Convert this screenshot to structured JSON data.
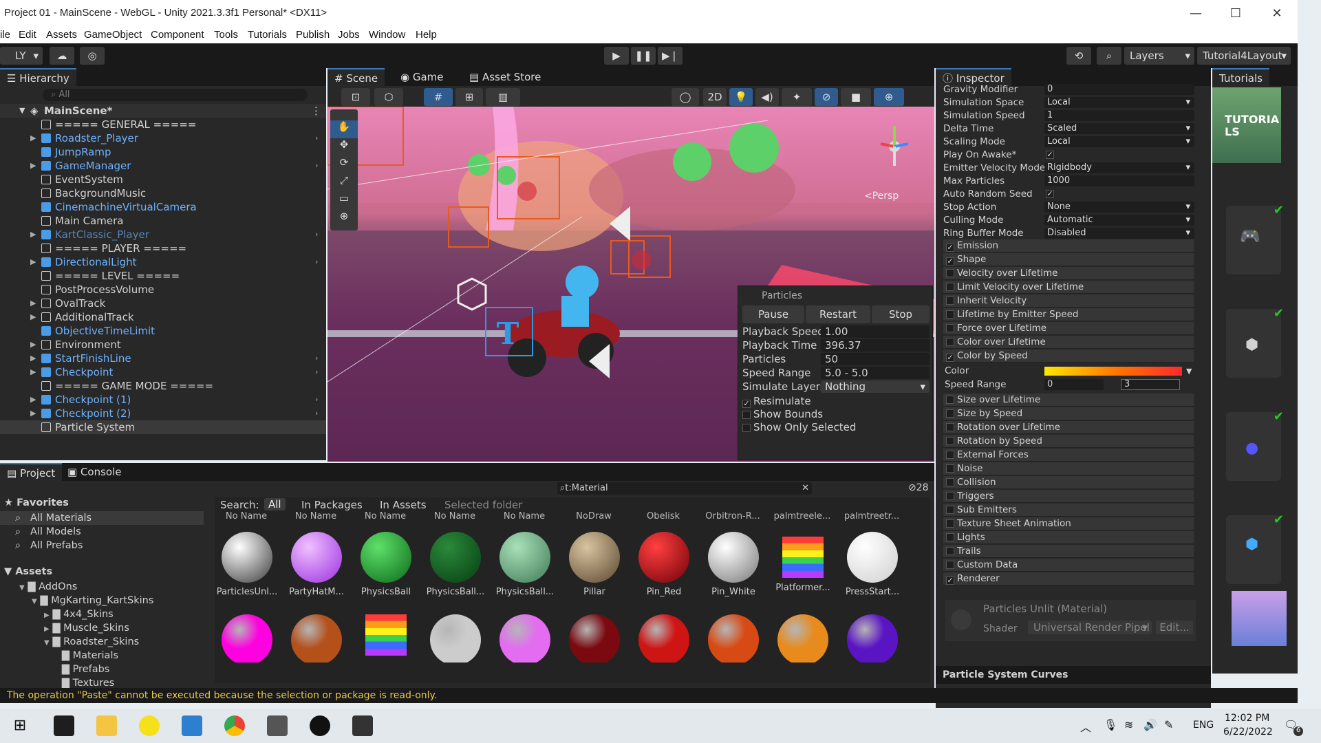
{
  "window": {
    "title": "Project 01 - MainScene - WebGL - Unity 2021.3.3f1 Personal* <DX11>"
  },
  "menu": [
    "ile",
    "Edit",
    "Assets",
    "GameObject",
    "Component",
    "Tools",
    "Tutorials",
    "Publish",
    "Jobs",
    "Window",
    "Help"
  ],
  "toolbar": {
    "account": "LY",
    "layers": "Layers",
    "layout": "Tutorial4Layout"
  },
  "hierarchy": {
    "tab": "Hierarchy",
    "search_placeholder": "All",
    "scene": "MainScene*",
    "items": [
      {
        "label": "===== GENERAL =====",
        "blue": false,
        "arrow": false
      },
      {
        "label": "Roadster_Player",
        "blue": true,
        "arrow": true
      },
      {
        "label": "JumpRamp",
        "blue": true,
        "arrow": false
      },
      {
        "label": "GameManager",
        "blue": true,
        "arrow": true
      },
      {
        "label": "EventSystem",
        "blue": false,
        "arrow": false
      },
      {
        "label": "BackgroundMusic",
        "blue": false,
        "arrow": false
      },
      {
        "label": "CinemachineVirtualCamera",
        "blue": true,
        "arrow": false
      },
      {
        "label": "Main Camera",
        "blue": false,
        "arrow": false
      },
      {
        "label": "KartClassic_Player",
        "blue": true,
        "arrow": true,
        "dim": true
      },
      {
        "label": "===== PLAYER =====",
        "blue": false,
        "arrow": false
      },
      {
        "label": "DirectionalLight",
        "blue": true,
        "arrow": true
      },
      {
        "label": "===== LEVEL =====",
        "blue": false,
        "arrow": false
      },
      {
        "label": "PostProcessVolume",
        "blue": false,
        "arrow": false
      },
      {
        "label": "OvalTrack",
        "blue": false,
        "arrow": true
      },
      {
        "label": "AdditionalTrack",
        "blue": false,
        "arrow": true
      },
      {
        "label": "ObjectiveTimeLimit",
        "blue": true,
        "arrow": false
      },
      {
        "label": "Environment",
        "blue": false,
        "arrow": true
      },
      {
        "label": "StartFinishLine",
        "blue": true,
        "arrow": true
      },
      {
        "label": "Checkpoint",
        "blue": true,
        "arrow": true
      },
      {
        "label": "===== GAME MODE =====",
        "blue": false,
        "arrow": false
      },
      {
        "label": "Checkpoint (1)",
        "blue": true,
        "arrow": true
      },
      {
        "label": "Checkpoint (2)",
        "blue": true,
        "arrow": true
      },
      {
        "label": "Particle System",
        "blue": false,
        "arrow": false
      }
    ]
  },
  "scene": {
    "tabs": [
      "Scene",
      "Game",
      "Asset Store"
    ],
    "persp": "<Persp",
    "btn2d": "2D"
  },
  "particles": {
    "title": "Particles",
    "pause": "Pause",
    "restart": "Restart",
    "stop": "Stop",
    "rows": [
      {
        "k": "Playback Speed",
        "v": "1.00"
      },
      {
        "k": "Playback Time",
        "v": "396.37"
      },
      {
        "k": "Particles",
        "v": "50"
      },
      {
        "k": "Speed Range",
        "v": "5.0 - 5.0"
      },
      {
        "k": "Simulate Layers",
        "v": "Nothing"
      }
    ],
    "checks": [
      {
        "k": "Resimulate",
        "on": true
      },
      {
        "k": "Show Bounds",
        "on": false
      },
      {
        "k": "Show Only Selected",
        "on": false
      }
    ]
  },
  "inspector": {
    "tab": "Inspector",
    "props": [
      {
        "k": "Gravity Modifier",
        "v": "0",
        "dd": false
      },
      {
        "k": "Simulation Space",
        "v": "Local",
        "dd": true
      },
      {
        "k": "Simulation Speed",
        "v": "1",
        "dd": false
      },
      {
        "k": "Delta Time",
        "v": "Scaled",
        "dd": true
      },
      {
        "k": "Scaling Mode",
        "v": "Local",
        "dd": true
      },
      {
        "k": "Play On Awake*",
        "v": "✓",
        "dd": false,
        "check": true
      },
      {
        "k": "Emitter Velocity Mode",
        "v": "Rigidbody",
        "dd": true
      },
      {
        "k": "Max Particles",
        "v": "1000",
        "dd": false
      },
      {
        "k": "Auto Random Seed",
        "v": "✓",
        "dd": false,
        "check": true
      },
      {
        "k": "Stop Action",
        "v": "None",
        "dd": true
      },
      {
        "k": "Culling Mode",
        "v": "Automatic",
        "dd": true
      },
      {
        "k": "Ring Buffer Mode",
        "v": "Disabled",
        "dd": true
      }
    ],
    "modules_a": [
      {
        "k": "Emission",
        "on": true
      },
      {
        "k": "Shape",
        "on": true
      },
      {
        "k": "Velocity over Lifetime",
        "on": false
      },
      {
        "k": "Limit Velocity over Lifetime",
        "on": false
      },
      {
        "k": "Inherit Velocity",
        "on": false
      },
      {
        "k": "Lifetime by Emitter Speed",
        "on": false
      },
      {
        "k": "Force over Lifetime",
        "on": false
      },
      {
        "k": "Color over Lifetime",
        "on": false
      },
      {
        "k": "Color by Speed",
        "on": true
      }
    ],
    "color_label": "Color",
    "speed_range_label": "Speed Range",
    "speed_min": "0",
    "speed_max": "3",
    "modules_b": [
      {
        "k": "Size over Lifetime",
        "on": false
      },
      {
        "k": "Size by Speed",
        "on": false
      },
      {
        "k": "Rotation over Lifetime",
        "on": false
      },
      {
        "k": "Rotation by Speed",
        "on": false
      },
      {
        "k": "External Forces",
        "on": false
      },
      {
        "k": "Noise",
        "on": false
      },
      {
        "k": "Collision",
        "on": false
      },
      {
        "k": "Triggers",
        "on": false
      },
      {
        "k": "Sub Emitters",
        "on": false
      },
      {
        "k": "Texture Sheet Animation",
        "on": false
      },
      {
        "k": "Lights",
        "on": false
      },
      {
        "k": "Trails",
        "on": false
      },
      {
        "k": "Custom Data",
        "on": false
      },
      {
        "k": "Renderer",
        "on": true
      }
    ],
    "material": "Particles Unlit (Material)",
    "shader_label": "Shader",
    "shader": "Universal Render Pipel",
    "edit": "Edit...",
    "curves": "Particle System Curves"
  },
  "tutorials": {
    "tab": "Tutorials",
    "banner": "TUTORIA LS"
  },
  "project": {
    "tabs": [
      "Project",
      "Console"
    ],
    "search": "t:Material",
    "count": "28",
    "search_label": "Search:",
    "filters": [
      "All",
      "In Packages",
      "In Assets",
      "Selected folder"
    ],
    "favorites": "Favorites",
    "fav_items": [
      "All Materials",
      "All Models",
      "All Prefabs"
    ],
    "assets": "Assets",
    "tree": [
      {
        "label": "AddOns",
        "d": 1
      },
      {
        "label": "MgKarting_KartSkins",
        "d": 2
      },
      {
        "label": "4x4_Skins",
        "d": 3
      },
      {
        "label": "Muscle_Skins",
        "d": 3
      },
      {
        "label": "Roadster_Skins",
        "d": 3
      },
      {
        "label": "Materials",
        "d": 4
      },
      {
        "label": "Prefabs",
        "d": 4
      },
      {
        "label": "Textures",
        "d": 4
      }
    ],
    "top_labels": [
      "No Name",
      "No Name",
      "No Name",
      "No Name",
      "No Name",
      "NoDraw",
      "Obelisk",
      "Orbitron-R...",
      "palmtreele...",
      "palmtreetr..."
    ],
    "materials": [
      {
        "name": "ParticlesUnl...",
        "c1": "#ffffff",
        "c2": "#3a3a3a"
      },
      {
        "name": "PartyHatM...",
        "c1": "#f0c0ff",
        "c2": "#9b2fe0"
      },
      {
        "name": "PhysicsBall",
        "c1": "#5fe06a",
        "c2": "#0b6a1a"
      },
      {
        "name": "PhysicsBall...",
        "c1": "#2a8a3a",
        "c2": "#073d13"
      },
      {
        "name": "PhysicsBall...",
        "c1": "#a9e0b8",
        "c2": "#3f7a56"
      },
      {
        "name": "Pillar",
        "c1": "#d9c4a0",
        "c2": "#5a4630"
      },
      {
        "name": "Pin_Red",
        "c1": "#ff4040",
        "c2": "#700008"
      },
      {
        "name": "Pin_White",
        "c1": "#ffffff",
        "c2": "#777777"
      },
      {
        "name": "Platformer...",
        "c1": "#ff3b3b",
        "c2": "#3b6bff"
      },
      {
        "name": "PressStart...",
        "c1": "#ffffff",
        "c2": "#cfcfcf"
      }
    ],
    "row2": [
      "#ff00e0",
      "#b4501a",
      "#ff2020",
      "#cccccc",
      "#e36cf0",
      "#7a0a10",
      "#cf1414",
      "#d84a14",
      "#e88a1c",
      "#5b14c4"
    ]
  },
  "status": {
    "message": "The operation \"Paste\" cannot be executed because the selection or package is read-only."
  },
  "taskbar": {
    "lang": "ENG",
    "time": "12:02 PM",
    "date": "6/22/2022",
    "badge": "6"
  },
  "colors": {
    "accent": "#3a79bb",
    "blue_item": "#4a9be8",
    "panel": "#282828"
  }
}
